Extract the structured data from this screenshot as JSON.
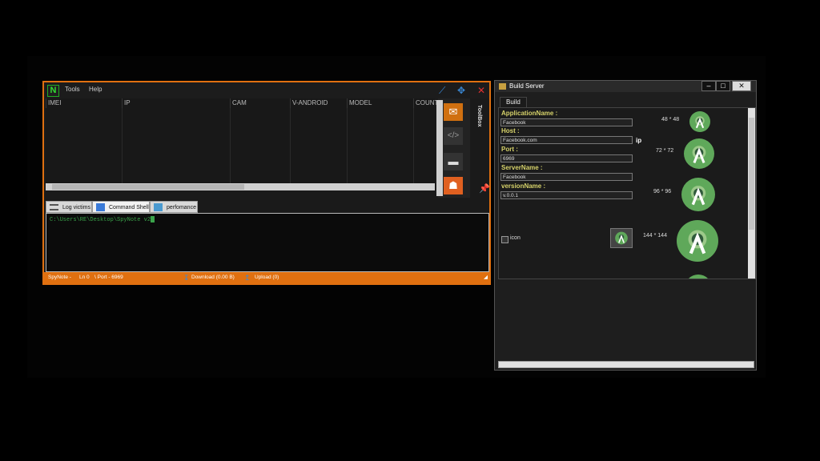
{
  "main_window": {
    "logo": "N",
    "menu": [
      "Tools",
      "Help"
    ],
    "titlebar_icons": [
      "pin-icon",
      "move-icon",
      "close-icon"
    ],
    "columns": [
      "IMEI",
      "IP",
      "CAM",
      "V-ANDROID",
      "MODEL",
      "COUNT"
    ],
    "toolbox_label": "ToolBox",
    "tools": [
      "mail-icon",
      "code-icon",
      "folder-icon",
      "contact-icon"
    ],
    "tabs": [
      {
        "label": "Log victims",
        "icon": "list-icon"
      },
      {
        "label": "Command Shell",
        "icon": "terminal-icon"
      },
      {
        "label": "perfomance",
        "icon": "chart-icon"
      }
    ],
    "active_tab": "Command Shell",
    "shell_prompt": "C:\\Users\\RE\\Desktop\\SpyNote v2",
    "status": {
      "app": "SpyNote -",
      "line": "Ln 0",
      "port": "\\ Port - 6969",
      "download": "Download (0.00 B)",
      "upload": "Upload  (0)"
    },
    "accent": "#e07010"
  },
  "build_window": {
    "title": "Build Server",
    "controls": [
      "minimize-icon",
      "maximize-icon",
      "close-icon"
    ],
    "tab": "Build",
    "fields": [
      {
        "label": "ApplicationName :",
        "value": "Facebook"
      },
      {
        "label": "Host :",
        "value": "Facebook.com"
      },
      {
        "label": "Port :",
        "value": "6969"
      },
      {
        "label": "ServerName :",
        "value": "Facebook"
      },
      {
        "label": "versionName :",
        "value": "v.0.0.1"
      }
    ],
    "ip_label": "ip",
    "icon_sizes": [
      "48 * 48",
      "72 * 72",
      "96 * 96",
      "144 * 144"
    ],
    "icon_checkbox_label": "icon",
    "icon_color": "#5fa85a",
    "label_color": "#d6d26a"
  }
}
